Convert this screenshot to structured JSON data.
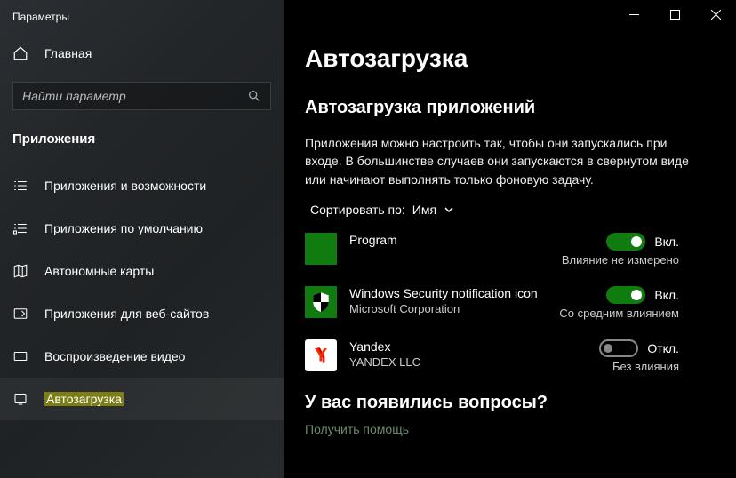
{
  "window": {
    "title": "Параметры"
  },
  "sidebar": {
    "home": "Главная",
    "search_placeholder": "Найти параметр",
    "section": "Приложения",
    "items": [
      {
        "label": "Приложения и возможности"
      },
      {
        "label": "Приложения по умолчанию"
      },
      {
        "label": "Автономные карты"
      },
      {
        "label": "Приложения для веб-сайтов"
      },
      {
        "label": "Воспроизведение видео"
      },
      {
        "label": "Автозагрузка"
      }
    ]
  },
  "main": {
    "title": "Автозагрузка",
    "subtitle": "Автозагрузка приложений",
    "description": "Приложения можно настроить так, чтобы они запускались при входе. В большинстве случаев они запускаются в свернутом виде или начинают выполнять только фоновую задачу.",
    "sort_label": "Сортировать по:",
    "sort_value": "Имя",
    "apps": [
      {
        "name": "Program",
        "publisher": "",
        "state_label": "Вкл.",
        "impact": "Влияние не измерено",
        "on": true
      },
      {
        "name": "Windows Security notification icon",
        "publisher": "Microsoft Corporation",
        "state_label": "Вкл.",
        "impact": "Со средним влиянием",
        "on": true
      },
      {
        "name": "Yandex",
        "publisher": "YANDEX LLC",
        "state_label": "Откл.",
        "impact": "Без влияния",
        "on": false
      }
    ],
    "question_header": "У вас появились вопросы?",
    "help_link": "Получить помощь"
  }
}
